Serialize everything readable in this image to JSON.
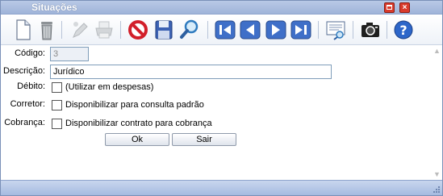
{
  "window": {
    "title": "Situações"
  },
  "form": {
    "codigo_label": "Código:",
    "codigo_value": "3",
    "descricao_label": "Descrição:",
    "descricao_value": "Jurídico",
    "debito_label": "Débito:",
    "debito_text": "(Utilizar em despesas)",
    "debito_checked": false,
    "corretor_label": "Corretor:",
    "corretor_text": "Disponibilizar para consulta padrão",
    "corretor_checked": false,
    "cobranca_label": "Cobrança:",
    "cobranca_text": "Disponibilizar contrato para cobrança",
    "cobranca_checked": false
  },
  "buttons": {
    "ok": "Ok",
    "sair": "Sair"
  },
  "toolbar_icons": [
    "new-document-icon",
    "trash-icon",
    "edit-icon",
    "print-icon",
    "cancel-icon",
    "save-icon",
    "search-icon",
    "first-record-icon",
    "previous-record-icon",
    "next-record-icon",
    "last-record-icon",
    "preview-icon",
    "camera-icon",
    "help-icon"
  ],
  "colors": {
    "titlebar": "#9fb4d9",
    "statusbar": "#b7c8e8",
    "close_button": "#d93a2b",
    "nav_blue": "#3f6fc8",
    "cancel_red": "#d21f2a"
  }
}
